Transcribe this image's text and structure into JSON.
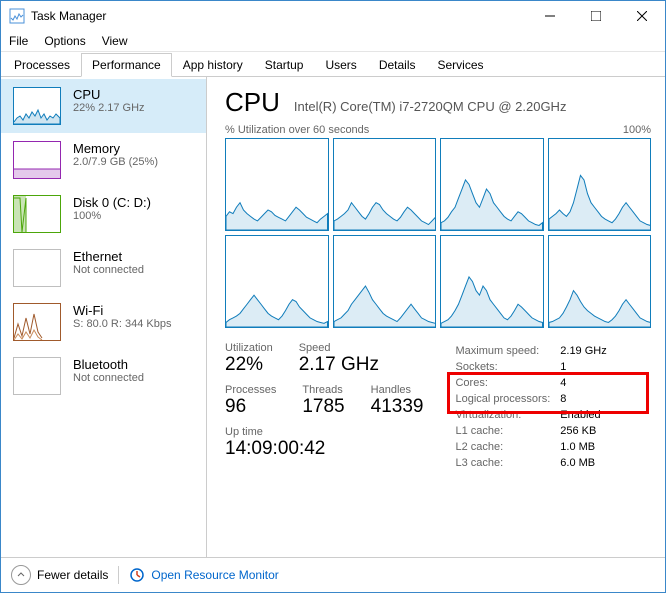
{
  "window": {
    "title": "Task Manager"
  },
  "menu": {
    "file": "File",
    "options": "Options",
    "view": "View"
  },
  "tabs": [
    "Processes",
    "Performance",
    "App history",
    "Startup",
    "Users",
    "Details",
    "Services"
  ],
  "active_tab": "Performance",
  "sidebar": [
    {
      "name": "CPU",
      "sub": "22% 2.17 GHz"
    },
    {
      "name": "Memory",
      "sub": "2.0/7.9 GB (25%)"
    },
    {
      "name": "Disk 0 (C: D:)",
      "sub": "100%"
    },
    {
      "name": "Ethernet",
      "sub": "Not connected"
    },
    {
      "name": "Wi-Fi",
      "sub": "S: 80.0 R: 344 Kbps"
    },
    {
      "name": "Bluetooth",
      "sub": "Not connected"
    }
  ],
  "active_side": 0,
  "cpu": {
    "title": "CPU",
    "model": "Intel(R) Core(TM) i7-2720QM CPU @ 2.20GHz",
    "graph_label": "% Utilization over 60 seconds",
    "graph_max": "100%",
    "left": {
      "util_l": "Utilization",
      "util_v": "22%",
      "speed_l": "Speed",
      "speed_v": "2.17 GHz",
      "proc_l": "Processes",
      "proc_v": "96",
      "thr_l": "Threads",
      "thr_v": "1785",
      "hnd_l": "Handles",
      "hnd_v": "41339",
      "up_l": "Up time",
      "up_v": "14:09:00:42"
    },
    "right": [
      [
        "Maximum speed:",
        "2.19 GHz"
      ],
      [
        "Sockets:",
        "1"
      ],
      [
        "Cores:",
        "4"
      ],
      [
        "Logical processors:",
        "8"
      ],
      [
        "Virtualization:",
        "Enabled"
      ],
      [
        "L1 cache:",
        "256 KB"
      ],
      [
        "L2 cache:",
        "1.0 MB"
      ],
      [
        "L3 cache:",
        "6.0 MB"
      ]
    ]
  },
  "footer": {
    "fewer": "Fewer details",
    "orm": "Open Resource Monitor"
  },
  "chart_data": {
    "type": "line",
    "note": "8 logical-processor utilization sparklines, 60s window, 0-100%",
    "ylim": [
      0,
      100
    ],
    "series": [
      {
        "name": "LP0",
        "values": [
          15,
          20,
          18,
          25,
          30,
          22,
          18,
          15,
          12,
          10,
          14,
          18,
          22,
          20,
          16,
          14,
          12,
          10,
          15,
          20,
          25,
          22,
          18,
          14,
          12,
          10,
          8,
          12,
          15,
          18
        ]
      },
      {
        "name": "LP1",
        "values": [
          10,
          12,
          15,
          18,
          22,
          30,
          25,
          20,
          15,
          12,
          18,
          25,
          30,
          28,
          22,
          18,
          15,
          12,
          10,
          14,
          20,
          25,
          22,
          18,
          14,
          10,
          8,
          6,
          10,
          14
        ]
      },
      {
        "name": "LP2",
        "values": [
          8,
          10,
          14,
          20,
          25,
          35,
          45,
          55,
          50,
          40,
          30,
          25,
          35,
          45,
          40,
          30,
          25,
          20,
          15,
          12,
          10,
          15,
          20,
          18,
          14,
          10,
          8,
          6,
          5,
          8
        ]
      },
      {
        "name": "LP3",
        "values": [
          12,
          15,
          18,
          22,
          18,
          15,
          20,
          30,
          45,
          60,
          55,
          40,
          30,
          25,
          20,
          15,
          12,
          10,
          8,
          12,
          18,
          25,
          30,
          25,
          20,
          15,
          10,
          8,
          6,
          5
        ]
      },
      {
        "name": "LP4",
        "values": [
          5,
          8,
          10,
          12,
          15,
          20,
          25,
          30,
          35,
          30,
          25,
          20,
          15,
          12,
          10,
          8,
          12,
          18,
          25,
          30,
          28,
          22,
          18,
          14,
          10,
          8,
          6,
          5,
          4,
          6
        ]
      },
      {
        "name": "LP5",
        "values": [
          6,
          8,
          10,
          14,
          18,
          25,
          30,
          35,
          40,
          45,
          38,
          30,
          25,
          20,
          15,
          12,
          10,
          8,
          6,
          10,
          15,
          20,
          25,
          20,
          15,
          10,
          8,
          6,
          5,
          4
        ]
      },
      {
        "name": "LP6",
        "values": [
          4,
          6,
          8,
          12,
          18,
          25,
          35,
          45,
          55,
          50,
          40,
          35,
          45,
          40,
          30,
          25,
          20,
          15,
          10,
          8,
          12,
          18,
          25,
          22,
          18,
          14,
          10,
          8,
          6,
          5
        ]
      },
      {
        "name": "LP7",
        "values": [
          5,
          6,
          8,
          10,
          15,
          22,
          30,
          40,
          35,
          28,
          22,
          18,
          15,
          12,
          10,
          8,
          6,
          5,
          8,
          12,
          18,
          25,
          30,
          25,
          20,
          15,
          10,
          8,
          6,
          5
        ]
      }
    ]
  }
}
